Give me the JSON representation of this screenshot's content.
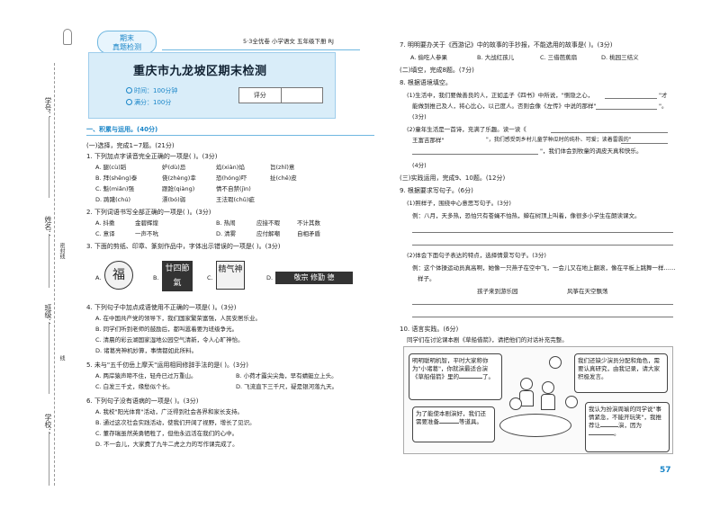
{
  "header": {
    "badge": "期末\n真题检测",
    "book_info": "5·3全优卷  小学语文  五年级下册  RJ",
    "title": "重庆市九龙坡区期末检测",
    "time": "时间：100分钟",
    "score": "满分：100分",
    "score_label": "评分"
  },
  "margin": {
    "exam_no": "学号：",
    "name": "姓名：",
    "class": "班级：",
    "school": "学校：",
    "seal_line": "密封线",
    "fold": "线"
  },
  "left": {
    "section1": "一、积累与运用。(40分)",
    "part1": "(一)选择，完成1~7题。(21分)",
    "q1": {
      "stem": "1. 下列加点字读音完全正确的一项是(    )。(3分)",
      "rows": [
        [
          "A. 腿(cù)蹈",
          "妒(dù)忌",
          "焰(xiàn)焰",
          "旨(zhǐ)意"
        ],
        [
          "B. 拜(shēng)泰",
          "侥(zhèng)幸",
          "恐(hóng)吓",
          "扯(chě)皮"
        ],
        [
          "C. 魁(miǎn)强",
          "跟跄(qiàng)",
          "情不自禁(jìn)",
          ""
        ],
        [
          "D. 踌躇(chú)",
          "漂(bó)弱",
          "王法瑕(chǔ)疵",
          ""
        ]
      ]
    },
    "q2": {
      "stem": "2. 下列词语书写全部正确的一项是(    )。(3分)",
      "rows": [
        [
          "A. 抖擞",
          "金碧辉煌",
          "B. 热闹",
          "应接不暇",
          "不计其数"
        ],
        [
          "C. 意译",
          "一声不吭",
          "D. 清雾",
          "应付解嘲",
          "自相矛盾"
        ]
      ]
    },
    "q3": {
      "stem": "3. 下面的剪纸、印章、篆刻作品中，字体出示错误的一项是(    )。(3分)",
      "opts": [
        "A.",
        "B.",
        "C.",
        "D."
      ],
      "seals": [
        "福",
        "廿四節氣",
        "精气神",
        "敬宗 修勤 德"
      ]
    },
    "q4": {
      "stem": "4. 下列句子中加点成语使用不正确的一项是(    )。(3分)",
      "opts": [
        "A. 在中国共产党的领导下，我们国家繁荣富强，人民安居乐业。",
        "B. 同学们听到老师的鼓励后，都叫嚣着要为班级争光。",
        "C. 清晨的彩云湖国家湿地公园空气清新，令人心旷神怡。",
        "D. 诸葛亮神机妙算，事情都如此所料。"
      ]
    },
    "q5": {
      "stem": "5. 未与\"五千仞岳上摩天\"运用相同修辞手法的是(    )。(3分)",
      "opts": [
        "A. 两岸猿声啼不住，轻舟已过万重山。",
        "B. 小荷才露尖尖角，早有蜻蜓立上头。",
        "C. 白发三千丈，缘愁似个长。",
        "D. 飞流直下三千尺，疑是银河落九天。"
      ]
    },
    "q6": {
      "stem": "6. 下列句子没有语病的一项是(    )。(3分)",
      "opts": [
        "A. 我校\"阳光体育\"活动，广泛得到社会各界和家长支持。",
        "B. 通过这次社会实践活动，使我们开阔了视野，增长了见识。",
        "C. 董存瑞虽然英勇牺牲了，但他永远活在我们的心中。",
        "D. 不一会儿，大家费了九牛二虎之力的写作课完成了。"
      ]
    }
  },
  "right": {
    "q7": {
      "stem": "7. 明明要办关于《西游记》中的故事的手抄报，不能选用的故事是(    )。(3分)",
      "opts": [
        "A. 偷吃人参果",
        "B. 大战红孩儿",
        "C. 三借芭蕉扇",
        "D. 桃园三结义"
      ]
    },
    "part2": "(二)填空，完成8题。(7分)",
    "q8": {
      "stem": "8. 根据语境填空。",
      "l1": "(1)生活中，我们要做善良的人，正如孟子《四书》中所说，\"恻隐之心，",
      "l1b": "\"才",
      "l2": "能做到推己及人，将心比心，以己度人。否则会像《左传》中说的那样\"",
      "l2b": "\"。",
      "l2c": "(3分)",
      "l3": "(2)童年生活是一首诗，充满了乐趣。读一读《",
      "l4": "王富吉那样\"",
      "l4b": "\"，我们感受到乡村儿童学种瓜时的纯朴、可爱；读着雷震的\"",
      "l5": "\"，我们体会到牧童的调皮天真和快乐。",
      "l6": "(4分)"
    },
    "part3": "(三)实践运用，完成9、10题。(12分)",
    "q9": {
      "stem": "9. 根据要求写句子。(6分)",
      "s1": "(1)照样子，围绕中心意思写句子。(3分)",
      "e1": "例：八月，天多热，恐怕只有苍蝇不怕热，蝉在树顶上叫着，像很多小学生在朗读课文。",
      "s2": "(2)体会下面句子表达的特点，选择情景写句子。(3分)",
      "e2": "例：这个体操运动员真高啊，她像一只燕子在空中飞，一会儿又在地上翻滚，像在平板上跳舞一样……",
      "e2b": "样子。",
      "choices": [
        "孩子来到游乐园",
        "风筝在天空飘荡"
      ]
    },
    "q10": {
      "stem": "10. 语言实践。(6分)",
      "desc": "同学们在讨论课本剧《草船借箭》，请把他们的对话补充完整。",
      "b1": "明明聪明机智，平时大家称你为\"小诸葛\"，你就演最适合演《草船借箭》里的",
      "b1b": "了。",
      "b2": "我们还缺少演员分配和角色，需要认真研究，由我记录，请大家积极发言。",
      "b3": "为了能使本剧演好，我们还需要准备",
      "b3b": "等道具。",
      "b4": "我认为扮演周瑜的同学说\"事情紧急，不能开玩笑\"，我推荐让",
      "b4b": "演，因为",
      "b4c": "。"
    }
  },
  "page_number": "57"
}
